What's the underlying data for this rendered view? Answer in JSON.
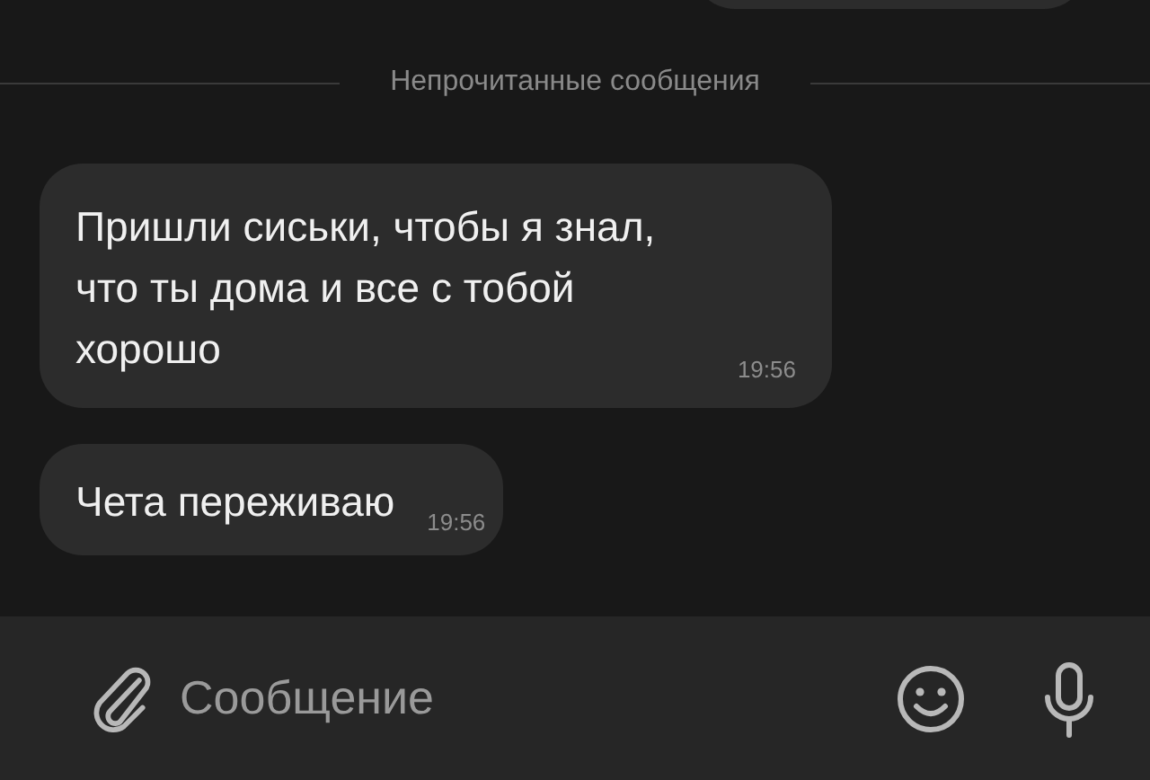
{
  "messages": [
    {
      "kind": "outgoing"
    },
    {
      "kind": "divider",
      "label": "Непрочитанные сообщения"
    },
    {
      "kind": "incoming",
      "text": "Пришли сиськи, чтобы я знал, что ты дома и все с тобой хорошо",
      "time": "19:56"
    },
    {
      "kind": "incoming",
      "text": "Чета переживаю",
      "time": "19:56"
    }
  ],
  "composer": {
    "placeholder": "Сообщение"
  }
}
